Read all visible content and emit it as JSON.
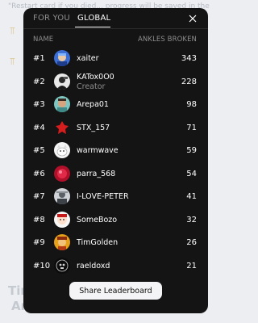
{
  "background": {
    "top_text": "\"Restart card if you died... progress will be saved in the",
    "bottom_line_1": "Tim",
    "bottom_line_2": "An"
  },
  "tabs": [
    {
      "label": "FOR YOU",
      "active": false
    },
    {
      "label": "GLOBAL",
      "active": true
    }
  ],
  "columns": {
    "name": "NAME",
    "score": "ANKLES BROKEN"
  },
  "rows": [
    {
      "rank": "#1",
      "name": "xaiter",
      "role": "",
      "score": "343",
      "avatar": "avatar-blue-face"
    },
    {
      "rank": "#2",
      "name": "KATox0O0",
      "role": "Creator",
      "score": "228",
      "avatar": "avatar-dark-figure"
    },
    {
      "rank": "#3",
      "name": "Arepa01",
      "role": "",
      "score": "98",
      "avatar": "avatar-teal-face"
    },
    {
      "rank": "#4",
      "name": "STX_157",
      "role": "",
      "score": "71",
      "avatar": "avatar-red-splash"
    },
    {
      "rank": "#5",
      "name": "warmwave",
      "role": "",
      "score": "59",
      "avatar": "avatar-white-dog"
    },
    {
      "rank": "#6",
      "name": "parra_568",
      "role": "",
      "score": "54",
      "avatar": "avatar-red-blob"
    },
    {
      "rank": "#7",
      "name": "I-LOVE-PETER",
      "role": "",
      "score": "41",
      "avatar": "avatar-gray-figure"
    },
    {
      "rank": "#8",
      "name": "SomeBozo",
      "role": "",
      "score": "32",
      "avatar": "avatar-white-red-face"
    },
    {
      "rank": "#9",
      "name": "TimGolden",
      "role": "",
      "score": "26",
      "avatar": "avatar-gold-face"
    },
    {
      "rank": "#10",
      "name": "raeldoxd",
      "role": "",
      "score": "21",
      "avatar": "avatar-black-skull"
    }
  ],
  "share_label": "Share Leaderboard",
  "colors": {
    "modal_bg": "#141414",
    "text": "#ffffff",
    "muted": "#8d8d8d",
    "button_bg": "#f4f4f6"
  }
}
